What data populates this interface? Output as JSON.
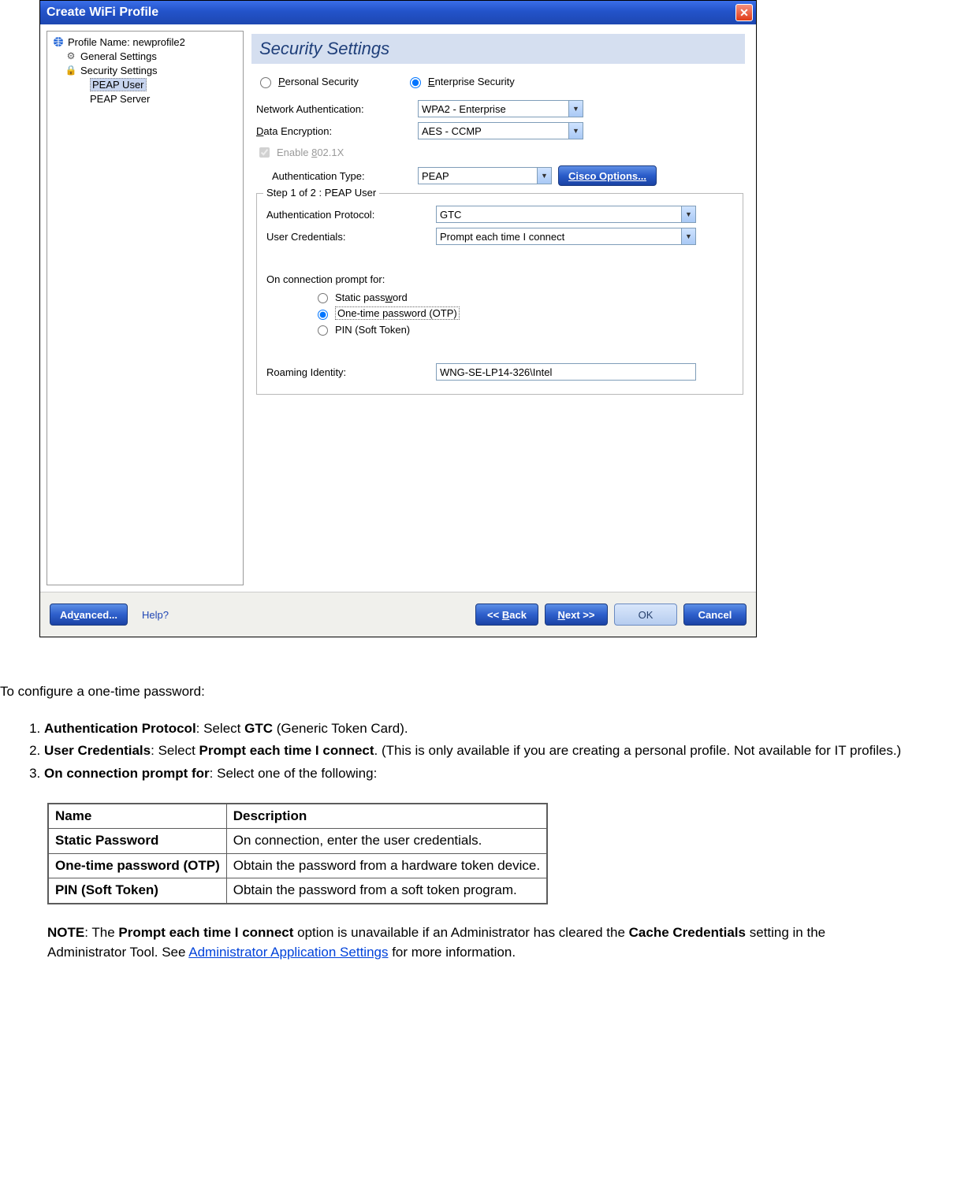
{
  "dialog": {
    "title": "Create WiFi Profile",
    "tree": {
      "root": "Profile Name: newprofile2",
      "items": [
        "General Settings",
        "Security Settings"
      ],
      "children": [
        "PEAP User",
        "PEAP Server"
      ],
      "selected": "PEAP User"
    },
    "section_title": "Security Settings",
    "radios": {
      "personal": "Personal Security",
      "enterprise": "Enterprise Security",
      "selected": "enterprise"
    },
    "net_auth": {
      "label": "Network Authentication:",
      "value": "WPA2 - Enterprise"
    },
    "data_enc": {
      "label": "Data Encryption:",
      "value": "AES - CCMP"
    },
    "enable8021x": {
      "label": "Enable 802.1X",
      "checked": true,
      "disabled": true
    },
    "auth_type": {
      "label": "Authentication Type:",
      "value": "PEAP"
    },
    "cisco_btn": "Cisco Options...",
    "step": {
      "legend": "Step 1 of 2 : PEAP User",
      "auth_proto": {
        "label": "Authentication Protocol:",
        "value": "GTC"
      },
      "user_cred": {
        "label": "User Credentials:",
        "value": "Prompt each time I connect"
      },
      "prompt_for": {
        "label": "On connection prompt for:",
        "options": {
          "static": "Static password",
          "otp": "One-time password (OTP)",
          "pin": "PIN (Soft Token)"
        },
        "selected": "otp"
      },
      "roaming": {
        "label": "Roaming Identity:",
        "value": "WNG-SE-LP14-326\\Intel"
      }
    },
    "buttons": {
      "advanced": "Advanced...",
      "help": "Help?",
      "back": "<< Back",
      "next": "Next >>",
      "ok": "OK",
      "cancel": "Cancel"
    }
  },
  "doc": {
    "intro": "To configure a one-time password:",
    "steps_html": {
      "s1a": "Authentication Protocol",
      "s1b": ": Select ",
      "s1c": "GTC",
      "s1d": " (Generic Token Card).",
      "s2a": "User Credentials",
      "s2b": ": Select ",
      "s2c": "Prompt each time I connect",
      "s2d": ". (This is only available if you are creating a personal profile. Not available for IT profiles.)",
      "s3a": "On connection prompt for",
      "s3b": ": Select one of the following:"
    },
    "table": {
      "head": {
        "name": "Name",
        "desc": "Description"
      },
      "rows": [
        {
          "name": "Static Password",
          "desc": "On connection, enter the user credentials."
        },
        {
          "name": "One-time password (OTP)",
          "desc": "Obtain the password from a hardware token device."
        },
        {
          "name": "PIN (Soft Token)",
          "desc": "Obtain the password from a soft token program."
        }
      ]
    },
    "note": {
      "lead": "NOTE",
      "t1": ": The ",
      "b1": "Prompt each time I connect",
      "t2": " option is unavailable if an Administrator has cleared the ",
      "b2": "Cache Credentials",
      "t3": " setting in the Administrator Tool. See ",
      "link": "Administrator Application Settings",
      "t4": " for more information."
    }
  }
}
